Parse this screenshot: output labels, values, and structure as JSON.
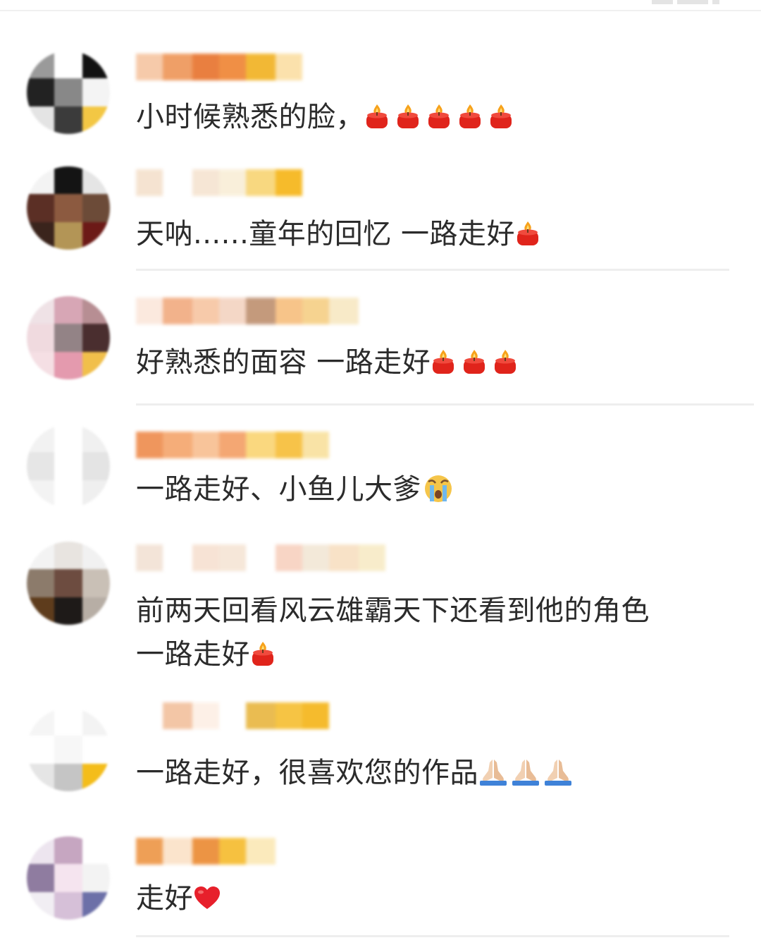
{
  "comments": [
    {
      "id": "c1",
      "avatar_colors": [
        "#9a9a9a",
        "#ffffff",
        "#111111",
        "#222222",
        "#888888",
        "#f4f4f4",
        "#e4e4e4",
        "#3b3b3b",
        "#f3c744"
      ],
      "username_blocks": [
        "#f6c8a6",
        "#ef9a5f",
        "#e87936",
        "#f08a3c",
        "#f2b52b",
        "#fbe0a8"
      ],
      "text": "小时候熟悉的脸，",
      "emoji": "candle",
      "emoji_count": 5
    },
    {
      "id": "c2",
      "avatar_colors": [
        "#f3f3f3",
        "#141414",
        "#e5e5e5",
        "#5b2f25",
        "#8c5a40",
        "#6c4b38",
        "#3a241c",
        "#b39556",
        "#6c1a17"
      ],
      "username_blocks": [
        "#f5e2cf",
        "#ffffff",
        "#f6e5d3",
        "#f9efd9",
        "#f8d67a",
        "#f6b820"
      ],
      "text": "天呐......童年的回忆 一路走好",
      "emoji": "candle",
      "emoji_count": 1
    },
    {
      "id": "c3",
      "avatar_colors": [
        "#efe2e6",
        "#d7a6b5",
        "#b78e93",
        "#f0dadf",
        "#938386",
        "#4a2e2f",
        "#f5dfe4",
        "#e49aae",
        "#f1bf4b"
      ],
      "username_blocks": [
        "#fbe8dd",
        "#f2ae85",
        "#f7c8a6",
        "#f4d5c4",
        "#c19576",
        "#f7c183",
        "#f6d18b",
        "#f8e9c6"
      ],
      "text": "好熟悉的面容 一路走好",
      "emoji": "candle",
      "emoji_count": 3
    },
    {
      "id": "c4",
      "avatar_colors": [
        "#f2f2f2",
        "#ffffff",
        "#f0f0f0",
        "#e6e6e6",
        "#ffffff",
        "#e4e4e4",
        "#f3f3f3",
        "#ffffff",
        "#efefef"
      ],
      "username_blocks": [
        "#ef9155",
        "#f5a972",
        "#f8c195",
        "#f4a36c",
        "#fad679",
        "#f7c040",
        "#f9e2a2"
      ],
      "text": "一路走好、小鱼儿大爹",
      "emoji": "cry",
      "emoji_count": 1
    },
    {
      "id": "c5",
      "avatar_colors": [
        "#f3f3f3",
        "#e8e4e0",
        "#f1f1f1",
        "#8c7b6b",
        "#6d4c40",
        "#c9c0b6",
        "#5e3c1c",
        "#1e1a18",
        "#b7aea5"
      ],
      "username_blocks": [
        "#f3e3d6",
        "#ffffff",
        "#f7e2d3",
        "#f6e6d7",
        "#ffffff",
        "#f8d3c2",
        "#f3e8d8",
        "#f8e1c5",
        "#f8ecc9"
      ],
      "text": "前两天回看风云雄霸天下还看到他的角色",
      "text_line2": "一路走好",
      "emoji": "candle",
      "emoji_count": 1
    },
    {
      "id": "c6",
      "avatar_colors": [
        "#f5f5f5",
        "#ffffff",
        "#f3f3f3",
        "#ffffff",
        "#f7f7f7",
        "#ffffff",
        "#e5e5e5",
        "#c5c5c5",
        "#f4bd1a"
      ],
      "username_blocks": [
        "#ffffff",
        "#f3c3a2",
        "#fdf0e6",
        "#ffffff",
        "#e9b948",
        "#f6c13a",
        "#f5b822"
      ],
      "text": "一路走好，很喜欢您的作品",
      "emoji": "pray",
      "emoji_count": 3
    },
    {
      "id": "c7",
      "avatar_colors": [
        "#ede5ef",
        "#c6a6c1",
        "#ffffff",
        "#8f7ca0",
        "#f5e4ef",
        "#f3f3f3",
        "#f1eef3",
        "#d6c0d8",
        "#6c70a8"
      ],
      "username_blocks": [
        "#ee9a4e",
        "#fbe3ca",
        "#ec8f3a",
        "#f6be36",
        "#fbe9b9"
      ],
      "text": "走好",
      "emoji": "heart",
      "emoji_count": 1
    }
  ]
}
